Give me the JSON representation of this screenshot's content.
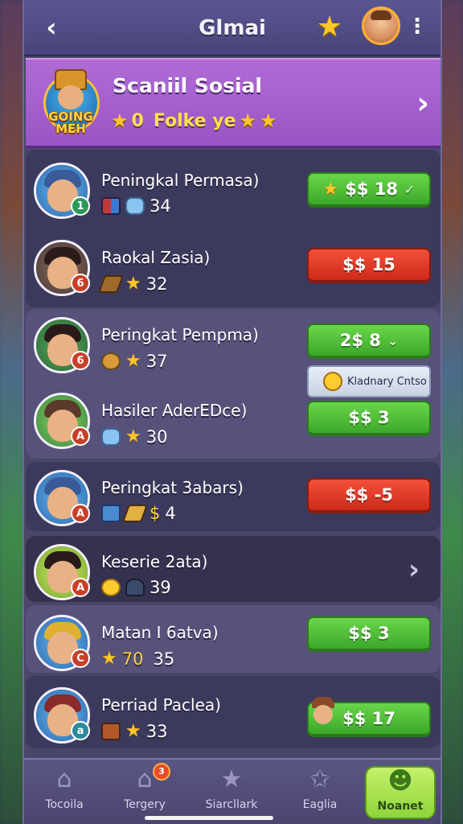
{
  "header": {
    "back_icon": "chevron-left-icon",
    "title": "Glmai",
    "star_icon": "star-icon",
    "menu_icon": "more-vertical-icon"
  },
  "banner": {
    "logo_text": "GOING MEH",
    "title": "Scaniil Sosial",
    "sub_count": "0",
    "sub_label": "Folke ye"
  },
  "rows": [
    {
      "name": "Peningkal Permasa)",
      "stat": "34",
      "button": "$$ 18",
      "button_color": "#3ca82a",
      "rank": "1"
    },
    {
      "name": "Raokal Zasia)",
      "stat": "32",
      "button": "$$ 15",
      "button_color": "#cc2a1a",
      "rank": "6"
    },
    {
      "name": "Peringkat Pempma)",
      "stat": "37",
      "button": "2$ 8",
      "button_color": "#3ca82a",
      "rank": "6",
      "tag": "Kladnary Cntso"
    },
    {
      "name": "Hasiler AderEDce)",
      "stat": "30",
      "button": "$$ 3",
      "button_color": "#3ca82a",
      "rank": "A"
    },
    {
      "name": "Peringkat 3abars)",
      "stat": "4",
      "button": "$$ -5",
      "button_color": "#cc2a1a",
      "rank": "A"
    },
    {
      "name": "Keserie 2ata)",
      "stat": "39",
      "rank": "A"
    },
    {
      "name": "Matan I 6atva)",
      "stat_gold": "70",
      "stat": "35",
      "button": "$$ 3",
      "button_color": "#3ca82a",
      "rank": "C"
    },
    {
      "name": "Perriad Paclea)",
      "stat": "33",
      "button": "$$ 17",
      "button_color": "#3ca82a",
      "rank": "a"
    }
  ],
  "nav": [
    {
      "label": "Tocoila",
      "icon": "home-icon"
    },
    {
      "label": "Tergery",
      "icon": "house-icon",
      "badge": "3"
    },
    {
      "label": "Siarcllark",
      "icon": "star-icon"
    },
    {
      "label": "Eaglia",
      "icon": "star-outline-icon"
    },
    {
      "label": "Noanet",
      "icon": "user-icon",
      "active": true
    }
  ]
}
